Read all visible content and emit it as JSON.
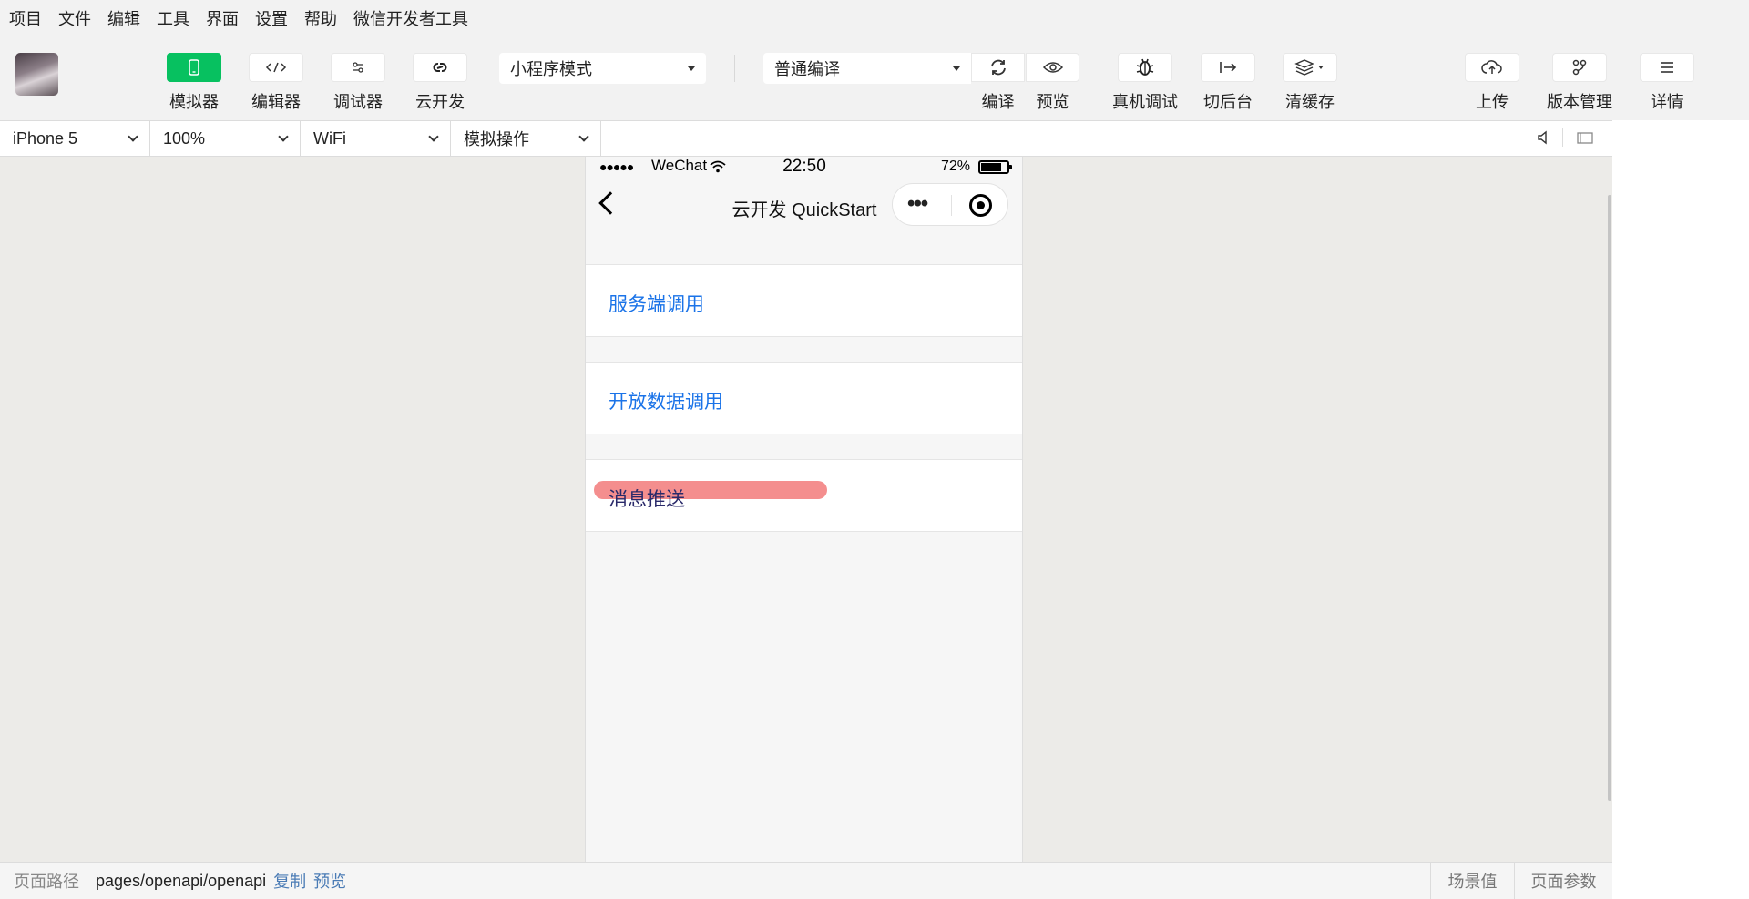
{
  "menubar": {
    "items": [
      "项目",
      "文件",
      "编辑",
      "工具",
      "界面",
      "设置",
      "帮助",
      "微信开发者工具"
    ]
  },
  "toolbar": {
    "simulator": "模拟器",
    "editor": "编辑器",
    "debugger": "调试器",
    "cloud": "云开发",
    "mode_select": "小程序模式",
    "compile_select": "普通编译",
    "compile": "编译",
    "preview": "预览",
    "remote_debug": "真机调试",
    "background": "切后台",
    "clear_cache": "清缓存",
    "upload": "上传",
    "version": "版本管理",
    "details": "详情",
    "accent_color": "#07c160"
  },
  "devicebar": {
    "device": "iPhone 5",
    "zoom": "100%",
    "network": "WiFi",
    "operation": "模拟操作"
  },
  "phone": {
    "signal": "●●●●●",
    "carrier": "WeChat",
    "time": "22:50",
    "battery": "72%",
    "nav_title": "云开发 QuickStart",
    "cells": [
      "服务端调用",
      "开放数据调用",
      "消息推送"
    ],
    "link_color": "#1a73e8"
  },
  "bottombar": {
    "path_label": "页面路径",
    "path_value": "pages/openapi/openapi",
    "copy": "复制",
    "preview": "预览",
    "scene": "场景值",
    "page_params": "页面参数"
  }
}
